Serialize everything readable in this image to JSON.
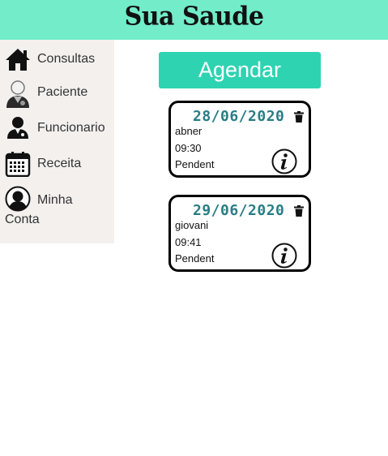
{
  "header": {
    "title": "Sua Saude"
  },
  "sidebar": {
    "items": [
      {
        "label": "Consultas",
        "icon": "house-icon"
      },
      {
        "label": "Paciente",
        "icon": "patient-icon"
      },
      {
        "label": "Funcionario",
        "icon": "doctor-icon"
      },
      {
        "label": "Receita",
        "icon": "calendar-icon"
      },
      {
        "label": "Minha Conta",
        "icon": "user-silhouette-icon"
      }
    ]
  },
  "main": {
    "agendar_label": "Agendar",
    "appointments": [
      {
        "date": "28/06/2020",
        "name": "abner",
        "time": "09:30",
        "status": "Pendent"
      },
      {
        "date": "29/06/2020",
        "name": "giovani",
        "time": "09:41",
        "status": "Pendent"
      }
    ]
  },
  "colors": {
    "header_bg": "#72ecc9",
    "sidebar_bg": "#f3f0ee",
    "button_bg": "#2ed3b2",
    "date_text": "#2a7d86"
  }
}
